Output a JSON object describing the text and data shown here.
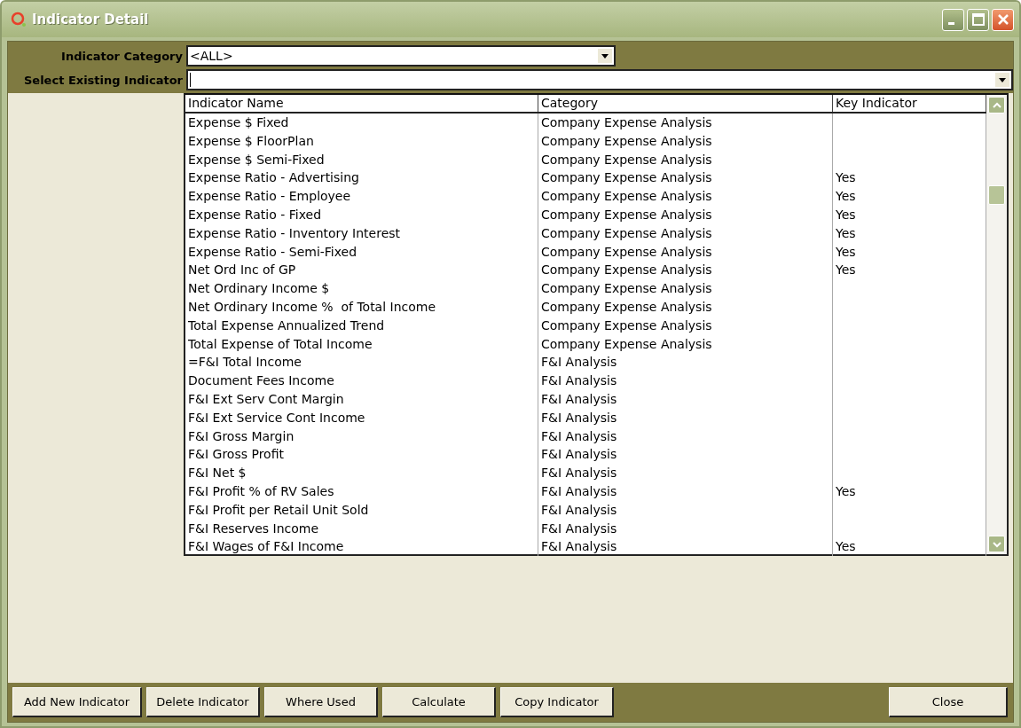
{
  "window": {
    "title": "Indicator Detail"
  },
  "category_filter": {
    "label": "Indicator Category",
    "value": "<ALL>"
  },
  "indicator_select": {
    "label": "Select Existing Indicator"
  },
  "table": {
    "columns": [
      "Indicator Name",
      "Category",
      "Key Indicator"
    ],
    "rows": [
      {
        "name": "Expense $ Fixed",
        "category": "Company Expense Analysis"
      },
      {
        "name": "Expense $ FloorPlan",
        "category": "Company Expense Analysis"
      },
      {
        "name": "Expense $ Semi-Fixed",
        "category": "Company Expense Analysis"
      },
      {
        "name": "Expense Ratio - Advertising",
        "category": "Company Expense Analysis",
        "key_indicator": "Yes"
      },
      {
        "name": "Expense Ratio - Employee",
        "category": "Company Expense Analysis",
        "key_indicator": "Yes"
      },
      {
        "name": "Expense Ratio - Fixed",
        "category": "Company Expense Analysis",
        "key_indicator": "Yes"
      },
      {
        "name": "Expense Ratio - Inventory Interest",
        "category": "Company Expense Analysis",
        "key_indicator": "Yes"
      },
      {
        "name": "Expense Ratio - Semi-Fixed",
        "category": "Company Expense Analysis",
        "key_indicator": "Yes"
      },
      {
        "name": "Net Ord Inc of GP",
        "category": "Company Expense Analysis",
        "key_indicator": "Yes"
      },
      {
        "name": "Net Ordinary Income $",
        "category": "Company Expense Analysis"
      },
      {
        "name": "Net Ordinary Income %  of Total Income",
        "category": "Company Expense Analysis"
      },
      {
        "name": "Total Expense Annualized Trend",
        "category": "Company Expense Analysis"
      },
      {
        "name": "Total Expense of Total Income",
        "category": "Company Expense Analysis"
      },
      {
        "name": "=F&I Total Income",
        "category": "F&I Analysis"
      },
      {
        "name": "Document Fees Income",
        "category": "F&I Analysis"
      },
      {
        "name": "F&I Ext Serv Cont Margin",
        "category": "F&I Analysis"
      },
      {
        "name": "F&I Ext Service Cont Income",
        "category": "F&I Analysis"
      },
      {
        "name": "F&I Gross Margin",
        "category": "F&I Analysis"
      },
      {
        "name": "F&I Gross Profit",
        "category": "F&I Analysis"
      },
      {
        "name": "F&I Net $",
        "category": "F&I Analysis"
      },
      {
        "name": "F&I Profit % of RV Sales",
        "category": "F&I Analysis",
        "key_indicator": "Yes"
      },
      {
        "name": "F&I Profit per Retail Unit Sold",
        "category": "F&I Analysis"
      },
      {
        "name": "F&I Reserves Income",
        "category": "F&I Analysis"
      },
      {
        "name": "F&I Wages of F&I Income",
        "category": "F&I Analysis",
        "key_indicator": "Yes"
      }
    ]
  },
  "buttons": [
    "Add New Indicator",
    "Delete Indicator",
    "Where Used",
    "Calculate",
    "Copy Indicator"
  ],
  "close_button": "Close"
}
